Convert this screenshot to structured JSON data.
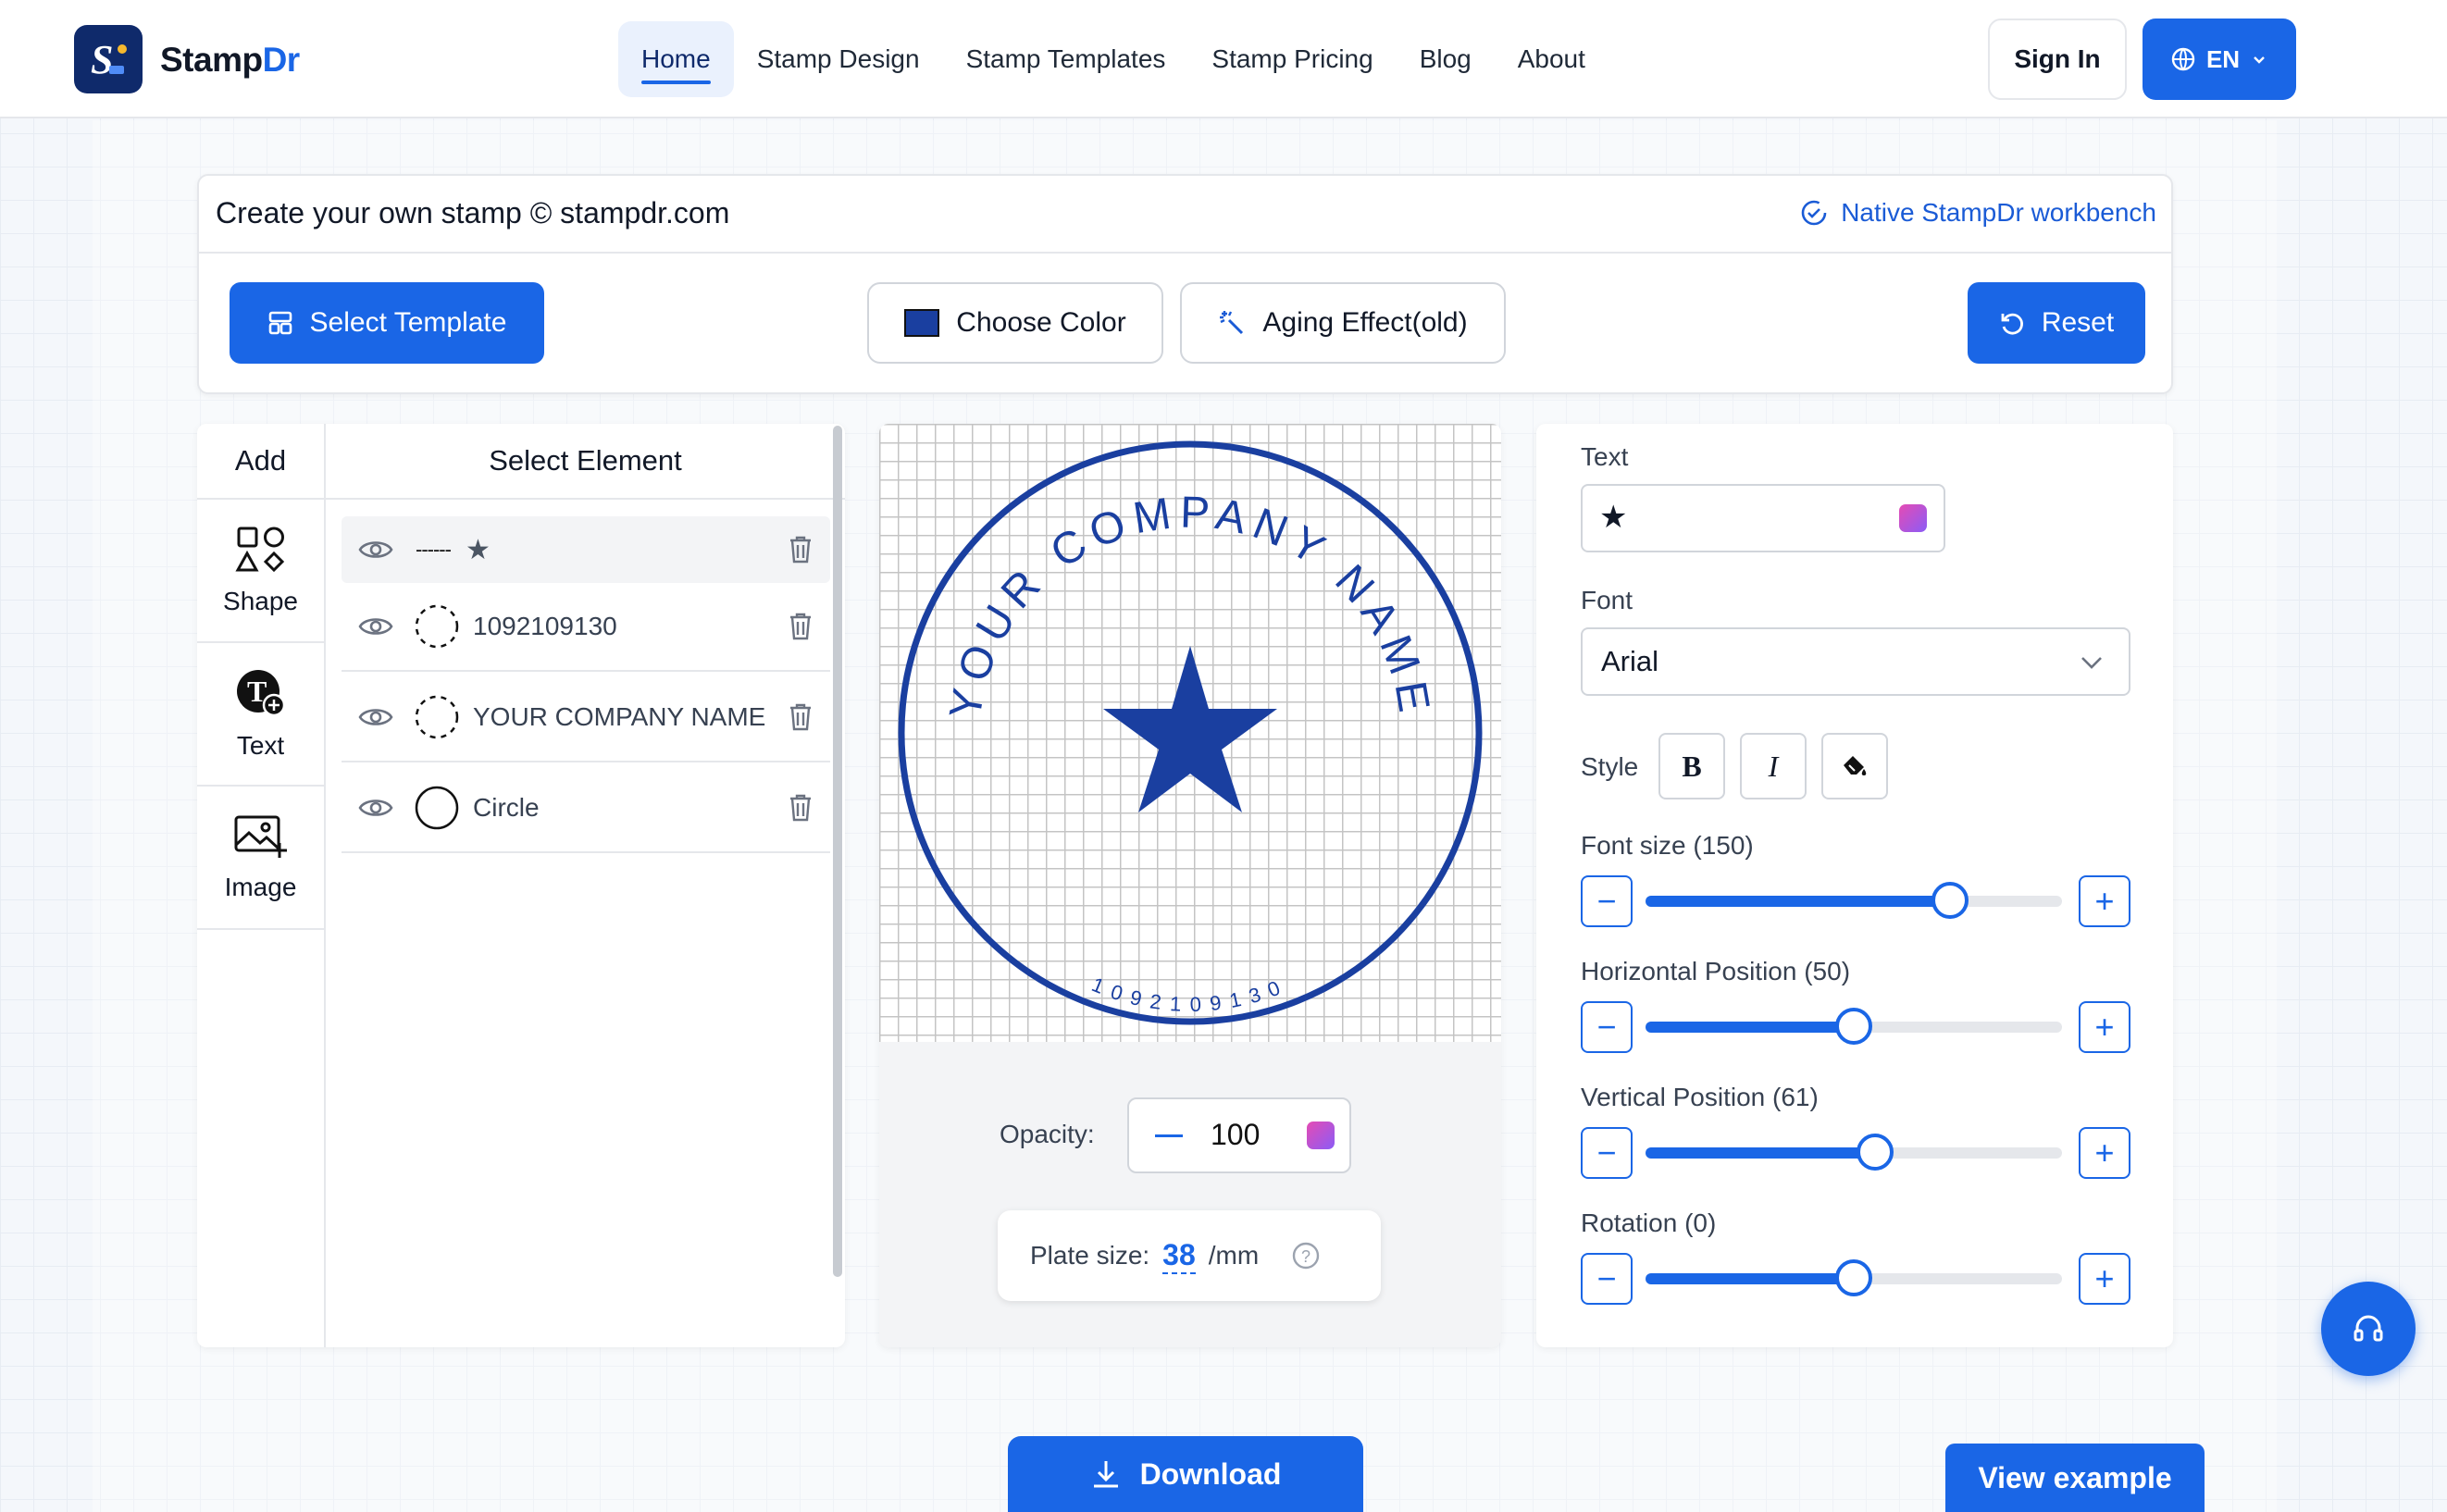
{
  "brand": {
    "name": "StampDr",
    "logo_color": "#0f2a6b"
  },
  "nav": {
    "items": [
      {
        "label": "Home",
        "active": true
      },
      {
        "label": "Stamp Design"
      },
      {
        "label": "Stamp Templates"
      },
      {
        "label": "Stamp Pricing"
      },
      {
        "label": "Blog"
      },
      {
        "label": "About"
      }
    ]
  },
  "header": {
    "sign_in": "Sign In",
    "language": "EN"
  },
  "toolbar": {
    "title": "Create your own stamp © stampdr.com",
    "badge": "Native StampDr workbench",
    "select_template": "Select Template",
    "choose_color": "Choose Color",
    "aging_effect": "Aging Effect(old)",
    "reset": "Reset",
    "stamp_color": "#1a3fa0"
  },
  "add_panel": {
    "title": "Add",
    "items": [
      {
        "label": "Shape",
        "icon": "shapes-icon"
      },
      {
        "label": "Text",
        "icon": "text-add-icon"
      },
      {
        "label": "Image",
        "icon": "image-add-icon"
      }
    ]
  },
  "elements": {
    "title": "Select Element",
    "rows": [
      {
        "dots": "------",
        "label": "★",
        "icon": "star-icon"
      },
      {
        "label": "1092109130",
        "icon": "dashed-circle-icon"
      },
      {
        "label": "YOUR COMPANY NAME",
        "icon": "dashed-circle-icon"
      },
      {
        "label": "Circle",
        "icon": "circle-icon"
      }
    ]
  },
  "stamp": {
    "top_text": "YOUR COMPANY NAME",
    "bottom_text": "1092109130",
    "center": "★"
  },
  "canvas": {
    "opacity_label": "Opacity:",
    "opacity_value": "100",
    "plate_label": "Plate size:",
    "plate_value": "38",
    "plate_unit": "/mm"
  },
  "props": {
    "text_label": "Text",
    "text_value": "★",
    "font_label": "Font",
    "font_value": "Arial",
    "style_label": "Style",
    "bold": "B",
    "italic": "I",
    "font_size_label": "Font size (150)",
    "font_size_pct": 73,
    "h_pos_label": "Horizontal Position (50)",
    "h_pos_pct": 50,
    "v_pos_label": "Vertical Position (61)",
    "v_pos_pct": 55,
    "rotation_label": "Rotation (0)",
    "rotation_pct": 50
  },
  "footer": {
    "download": "Download",
    "view_example": "View example"
  }
}
